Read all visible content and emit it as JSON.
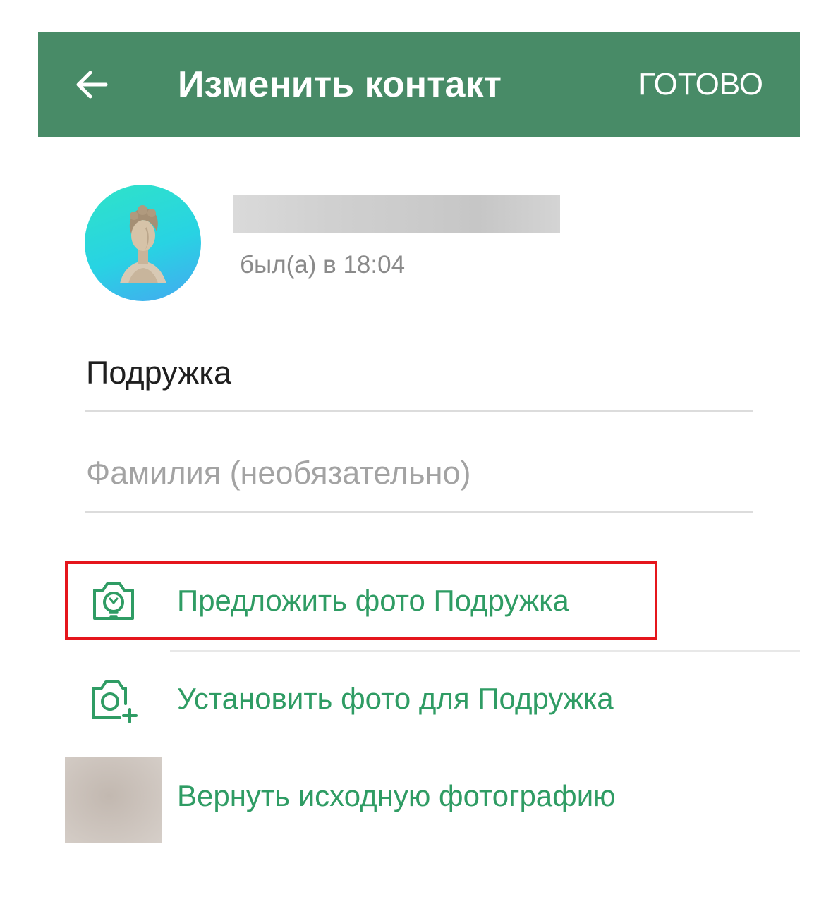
{
  "app": {
    "accent_color": "#488b67",
    "action_color": "#2f9c64",
    "highlight_color": "#e5161c"
  },
  "header": {
    "back_icon": "arrow-left-icon",
    "title": "Изменить контакт",
    "done_label": "ГОТОВО"
  },
  "contact": {
    "avatar": "avatar-image",
    "last_seen": "был(а) в 18:04"
  },
  "form": {
    "first_name_value": "Подружка",
    "last_name_placeholder": "Фамилия (необязательно)"
  },
  "actions": {
    "suggest_photo": {
      "icon": "camera-suggest-icon",
      "label": "Предложить фото Подружка"
    },
    "set_photo": {
      "icon": "camera-add-icon",
      "label": "Установить фото для Подружка"
    },
    "reset_photo": {
      "label": "Вернуть исходную фотографию"
    }
  }
}
